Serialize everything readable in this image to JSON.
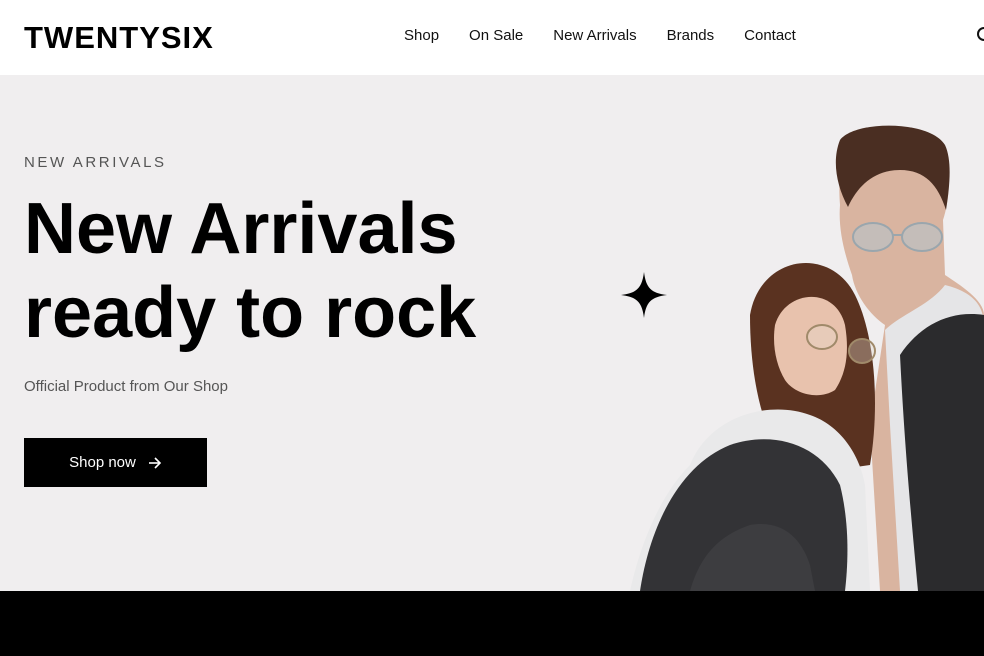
{
  "header": {
    "logo": "TWENTYSIX",
    "nav": [
      "Shop",
      "On Sale",
      "New Arrivals",
      "Brands",
      "Contact"
    ],
    "search_icon": "search-icon"
  },
  "hero": {
    "eyebrow": "NEW ARRIVALS",
    "headline_line1": "New Arrivals",
    "headline_line2": "ready to rock",
    "subtitle": "Official Product from Our Shop",
    "cta_label": "Shop now",
    "cta_icon": "arrow-right-icon",
    "decoration_icon": "sparkle-icon"
  },
  "colors": {
    "hero_bg": "#f0eeef",
    "primary": "#000000",
    "muted_text": "#555555"
  }
}
